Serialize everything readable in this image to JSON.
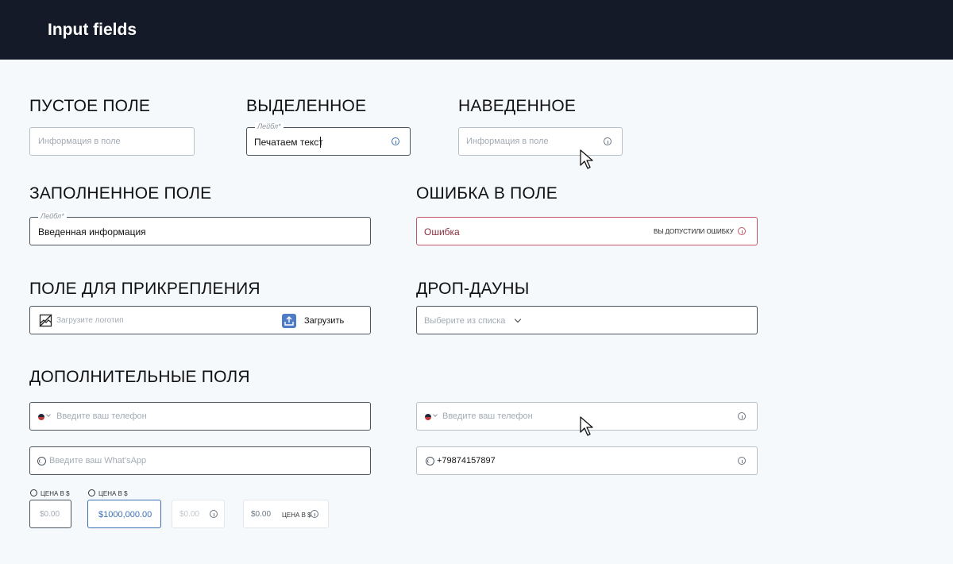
{
  "header": {
    "title": "Input fields"
  },
  "sections": {
    "empty": "ПУСТОЕ ПОЛЕ",
    "selected": "ВЫДЕЛЕННОЕ",
    "hovered": "НАВЕДЕННОЕ",
    "filled": "ЗАПОЛНЕННОЕ ПОЛЕ",
    "error": "ОШИБКА В ПОЛЕ",
    "attach": "ПОЛЕ ДЛЯ ПРИКРЕПЛЕНИЯ",
    "dropdowns": "ДРОП-ДАУНЫ",
    "extra": "ДОПОЛНИТЕЛЬНЫЕ ПОЛЯ"
  },
  "empty_field": {
    "placeholder": "Информация в поле"
  },
  "selected_field": {
    "label": "Лейбл*",
    "value": "Печатаем текст"
  },
  "hovered_field": {
    "placeholder": "Информация в поле"
  },
  "filled_field": {
    "label": "Лейбл*",
    "value": "Введенная информация"
  },
  "error_field": {
    "value": "Ошибка",
    "message": "вы допустили ошибку"
  },
  "attach_field": {
    "placeholder": "Загрузите логотип",
    "button_label": "Загрузить"
  },
  "dropdown_field": {
    "placeholder": "Выберите из списка"
  },
  "phone_field_1": {
    "placeholder": "Введите ваш телефон"
  },
  "phone_field_2": {
    "placeholder": "Введите ваш телефон"
  },
  "whatsapp_field_1": {
    "placeholder": "Введите ваш What'sApp"
  },
  "whatsapp_field_2": {
    "value": "+79874157897"
  },
  "price_fields": {
    "caption": "ЦЕНА В $",
    "p1_placeholder": "$0.00",
    "p2_value": "$1000,000.00",
    "p3_placeholder": "$0.00",
    "p4_placeholder": "$0.00",
    "p4_caption": "ЦЕНА В $"
  },
  "colors": {
    "header_bg": "#141a28",
    "accent": "#3d6fb5",
    "error": "#c4566a",
    "background": "#f6f9fc"
  }
}
